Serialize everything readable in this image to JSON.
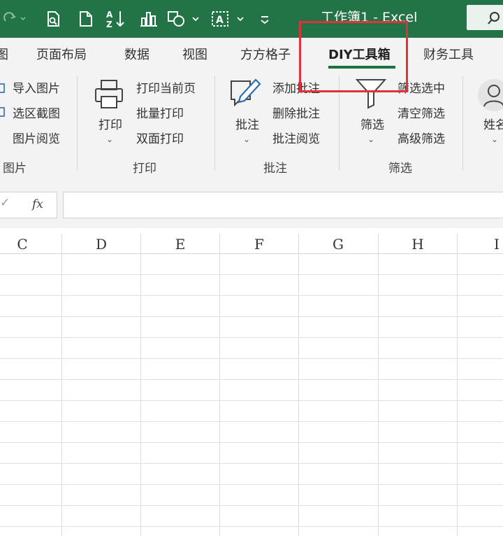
{
  "window": {
    "title": "工作簿1 - Excel"
  },
  "ribbon_tabs": [
    {
      "label": "图",
      "active": false
    },
    {
      "label": "页面布局",
      "active": false
    },
    {
      "label": "数据",
      "active": false
    },
    {
      "label": "视图",
      "active": false
    },
    {
      "label": "方方格子",
      "active": false
    },
    {
      "label": "DIY工具箱",
      "active": true
    },
    {
      "label": "财务工具",
      "active": false
    }
  ],
  "groups": {
    "picture": {
      "label": "图片",
      "items": [
        "导入图片",
        "选区截图",
        "图片阅览"
      ]
    },
    "print": {
      "label": "打印",
      "big_button": "打印",
      "items": [
        "打印当前页",
        "批量打印",
        "双面打印"
      ]
    },
    "comment": {
      "label": "批注",
      "big_button": "批注",
      "items": [
        "添加批注",
        "删除批注",
        "批注阅览"
      ]
    },
    "filter": {
      "label": "筛选",
      "big_button": "筛选",
      "items": [
        "筛选选中",
        "清空筛选",
        "高级筛选"
      ]
    },
    "name": {
      "big_button": "姓名"
    }
  },
  "formula_bar": {
    "fx_label": "fx",
    "value": ""
  },
  "columns": [
    "C",
    "D",
    "E",
    "F",
    "G",
    "H",
    "I"
  ],
  "colors": {
    "title_bar": "#227447",
    "tab_underline": "#1e7145",
    "highlight": "#e2313a"
  }
}
